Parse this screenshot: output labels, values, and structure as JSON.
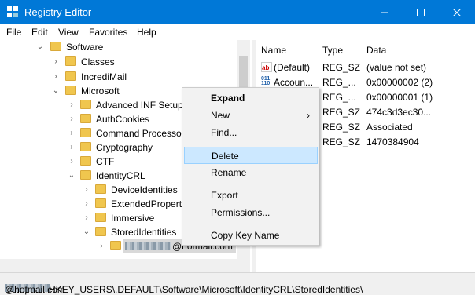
{
  "window": {
    "title": "Registry Editor"
  },
  "menubar": [
    "File",
    "Edit",
    "View",
    "Favorites",
    "Help"
  ],
  "tree": [
    {
      "label": "Software",
      "expanded": true
    },
    {
      "label": "Classes",
      "expanded": false
    },
    {
      "label": "IncrediMail",
      "expanded": false
    },
    {
      "label": "Microsoft",
      "expanded": true
    },
    {
      "label": "Advanced INF Setup",
      "expanded": false
    },
    {
      "label": "AuthCookies",
      "expanded": false
    },
    {
      "label": "Command Processor",
      "expanded": false
    },
    {
      "label": "Cryptography",
      "expanded": false
    },
    {
      "label": "CTF",
      "expanded": false
    },
    {
      "label": "IdentityCRL",
      "expanded": true
    },
    {
      "label": "DeviceIdentities",
      "expanded": false
    },
    {
      "label": "ExtendedProperti",
      "expanded": false
    },
    {
      "label": "Immersive",
      "expanded": false
    },
    {
      "label": "StoredIdentities",
      "expanded": true
    },
    {
      "label": "@hotmail.com",
      "expanded": false,
      "selected": true
    }
  ],
  "list": {
    "headers": [
      "Name",
      "Type",
      "Data"
    ],
    "rows": [
      {
        "name": "(Default)",
        "type": "REG_SZ",
        "data": "(value not set)",
        "icon": "string-value-icon"
      },
      {
        "name": "Accoun...",
        "type": "REG_...",
        "data": "0x00000002 (2)",
        "icon": "binary-value-icon"
      },
      {
        "name": "",
        "type": "REG_...",
        "data": "0x00000001 (1)",
        "icon": ""
      },
      {
        "name": "",
        "type": "REG_SZ",
        "data": "474c3d3ec30...",
        "icon": ""
      },
      {
        "name": "",
        "type": "REG_SZ",
        "data": "Associated",
        "icon": ""
      },
      {
        "name": "",
        "type": "REG_SZ",
        "data": "1470384904",
        "icon": ""
      }
    ]
  },
  "context_menu": {
    "items": [
      {
        "label": "Expand",
        "bold": true
      },
      {
        "label": "New",
        "submenu": true
      },
      {
        "label": "Find..."
      },
      {
        "separator": true
      },
      {
        "label": "Delete",
        "highlighted": true
      },
      {
        "label": "Rename"
      },
      {
        "separator": true
      },
      {
        "label": "Export"
      },
      {
        "label": "Permissions..."
      },
      {
        "separator": true
      },
      {
        "label": "Copy Key Name"
      }
    ]
  },
  "status": {
    "path": "Computer\\HKEY_USERS\\.DEFAULT\\Software\\Microsoft\\IdentityCRL\\StoredIdentities\\",
    "suffix": "@hotmail.com"
  },
  "colors": {
    "titlebar": "#0078d7",
    "folder": "#f0c64e",
    "highlight": "#cce8ff"
  }
}
